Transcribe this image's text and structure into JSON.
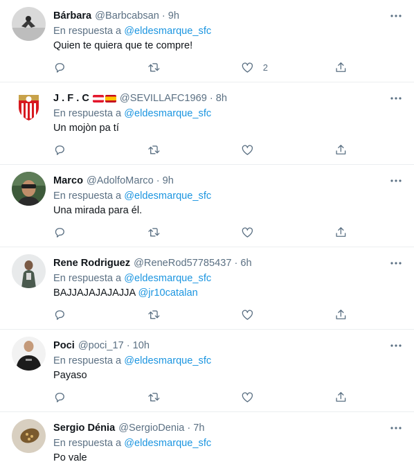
{
  "reply_prefix": "En respuesta a",
  "colors": {
    "text": "#0f1419",
    "secondary": "#5b7083",
    "link": "#1b95e0",
    "divider": "#ebeef0"
  },
  "icons": {
    "reply": "reply-icon",
    "retweet": "retweet-icon",
    "like": "heart-icon",
    "share": "share-icon",
    "more": "more-icon"
  },
  "tweets": [
    {
      "name": "Bárbara",
      "handle": "@Barbcabsan",
      "time": "9h",
      "reply_to": "@eldesmarque_sfc",
      "text": "Quien te quiera que te compre!",
      "text_mention": "",
      "likes": "2",
      "flags": []
    },
    {
      "name": "J . F . C",
      "handle": "@SEVILLAFC1969",
      "time": "8h",
      "reply_to": "@eldesmarque_sfc",
      "text": "Un mojòn pa tí",
      "text_mention": "",
      "likes": "",
      "flags": [
        "austria-flag",
        "spain-flag"
      ]
    },
    {
      "name": "Marco",
      "handle": "@AdolfoMarco",
      "time": "9h",
      "reply_to": "@eldesmarque_sfc",
      "text": "Una mirada para él.",
      "text_mention": "",
      "likes": "",
      "flags": []
    },
    {
      "name": "Rene Rodriguez",
      "handle": "@ReneRod57785437",
      "time": "6h",
      "reply_to": "@eldesmarque_sfc",
      "text": "BAJJAJAJAJAJJA",
      "text_mention": "@jr10catalan",
      "likes": "",
      "flags": []
    },
    {
      "name": "Poci",
      "handle": "@poci_17",
      "time": "10h",
      "reply_to": "@eldesmarque_sfc",
      "text": "Payaso",
      "text_mention": "",
      "likes": "",
      "flags": []
    },
    {
      "name": "Sergio Dénia",
      "handle": "@SergioDenia",
      "time": "7h",
      "reply_to": "@eldesmarque_sfc",
      "text": "Po vale",
      "text_mention": "",
      "likes": "",
      "flags": []
    }
  ]
}
